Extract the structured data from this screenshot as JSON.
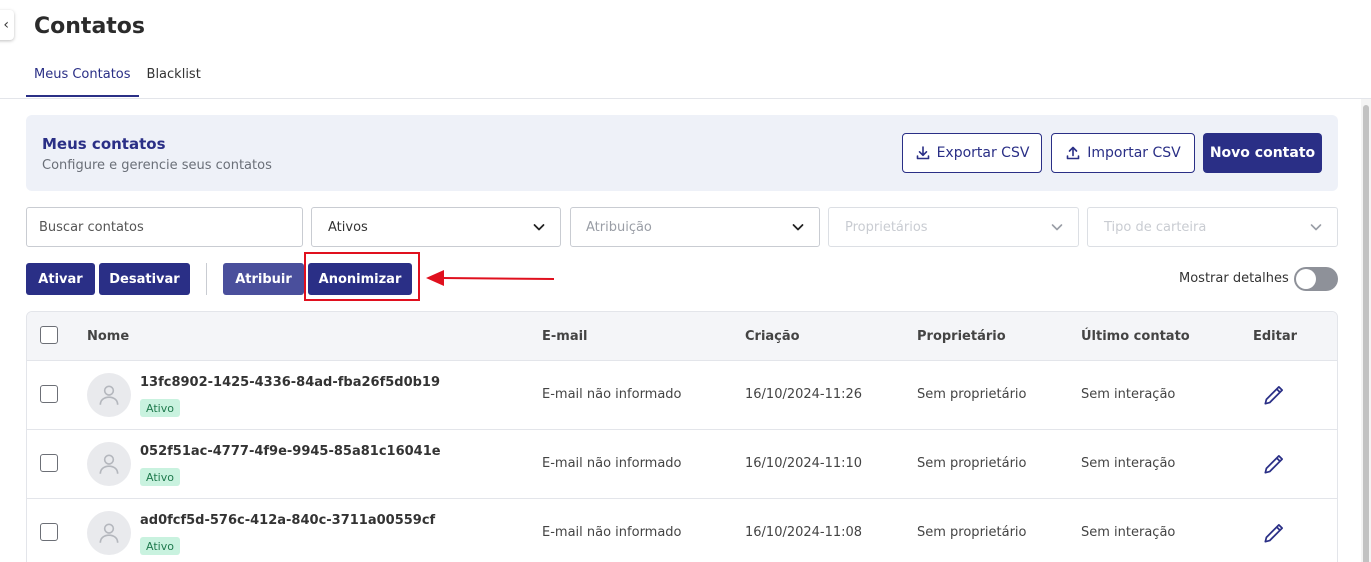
{
  "page": {
    "title": "Contatos"
  },
  "tabs": [
    {
      "label": "Meus Contatos",
      "active": true
    },
    {
      "label": "Blacklist",
      "active": false
    }
  ],
  "header_panel": {
    "title": "Meus contatos",
    "subtitle": "Configure e gerencie seus contatos",
    "export_label": "Exportar CSV",
    "import_label": "Importar CSV",
    "new_label": "Novo contato"
  },
  "filters": {
    "search_placeholder": "Buscar contatos",
    "status_value": "Ativos",
    "assignment_placeholder": "Atribuição",
    "owners_placeholder": "Proprietários",
    "wallet_placeholder": "Tipo de carteira"
  },
  "actions": {
    "activate": "Ativar",
    "deactivate": "Desativar",
    "assign": "Atribuir",
    "anonymize": "Anonimizar"
  },
  "toggle": {
    "label": "Mostrar detalhes",
    "on": false
  },
  "table": {
    "columns": [
      "Nome",
      "E-mail",
      "Criação",
      "Proprietário",
      "Último contato",
      "Editar"
    ],
    "rows": [
      {
        "name": "13fc8902-1425-4336-84ad-fba26f5d0b19",
        "status": "Ativo",
        "email": "E-mail não informado",
        "created": "16/10/2024-11:26",
        "owner": "Sem proprietário",
        "last_contact": "Sem interação"
      },
      {
        "name": "052f51ac-4777-4f9e-9945-85a81c16041e",
        "status": "Ativo",
        "email": "E-mail não informado",
        "created": "16/10/2024-11:10",
        "owner": "Sem proprietário",
        "last_contact": "Sem interação"
      },
      {
        "name": "ad0fcf5d-576c-412a-840c-3711a00559cf",
        "status": "Ativo",
        "email": "E-mail não informado",
        "created": "16/10/2024-11:08",
        "owner": "Sem proprietário",
        "last_contact": "Sem interação"
      }
    ]
  },
  "icons": {
    "back": "chevron-left-icon",
    "export": "download-icon",
    "import": "upload-icon",
    "dropdown": "chevron-down-icon",
    "avatar": "user-icon",
    "edit": "pencil-icon"
  },
  "colors": {
    "primary": "#2a2f86",
    "highlight": "#e0101e",
    "badge_bg": "#c9f2df",
    "badge_text": "#1f7a4d"
  }
}
